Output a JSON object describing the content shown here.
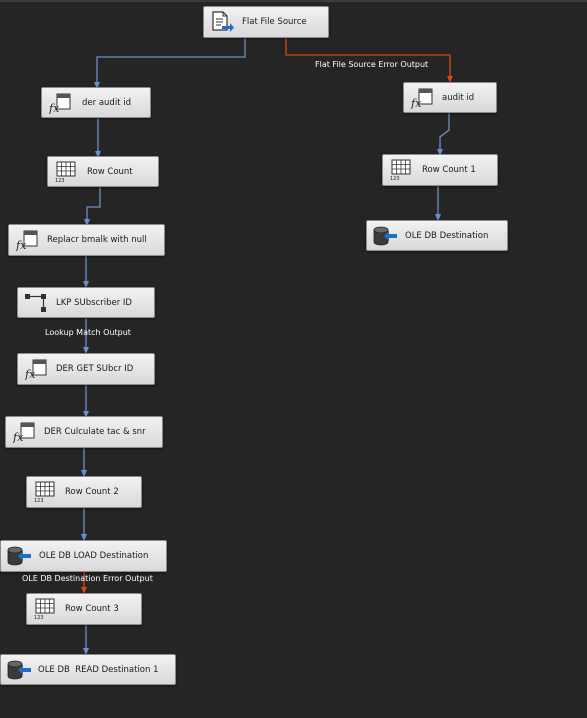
{
  "nodes": {
    "flat_file_source": {
      "label": "Flat File Source",
      "icon": "flat-file-source-icon"
    },
    "der_audit_id": {
      "label": "der audit id",
      "icon": "derived-column-icon"
    },
    "audit_id": {
      "label": "audit id",
      "icon": "derived-column-icon"
    },
    "row_count": {
      "label": "Row Count",
      "icon": "row-count-icon"
    },
    "row_count_1": {
      "label": "Row Count 1",
      "icon": "row-count-icon"
    },
    "replace_blank": {
      "label": "Replacr bmalk with null",
      "icon": "derived-column-icon"
    },
    "ole_db_destination": {
      "label": "OLE DB Destination",
      "icon": "ole-db-destination-icon"
    },
    "lkp_subscriber": {
      "label": "LKP SUbscriber ID",
      "icon": "lookup-icon"
    },
    "der_get_subcr": {
      "label": "DER GET SUbcr ID",
      "icon": "derived-column-icon"
    },
    "der_calculate": {
      "label": "DER Culculate tac & snr",
      "icon": "derived-column-icon"
    },
    "row_count_2": {
      "label": "Row Count 2",
      "icon": "row-count-icon"
    },
    "ole_db_load": {
      "label": "OLE DB LOAD Destination",
      "icon": "ole-db-destination-icon"
    },
    "row_count_3": {
      "label": "Row Count 3",
      "icon": "row-count-icon"
    },
    "ole_db_read": {
      "label": "OLE DB  READ Destination 1",
      "icon": "ole-db-destination-icon"
    }
  },
  "path_labels": {
    "flat_file_error": "Flat File Source Error Output",
    "lookup_match": "Lookup Match Output",
    "ole_db_error": "OLE DB Destination Error Output"
  },
  "colors": {
    "background": "#252525",
    "success_path": "#6b8fc7",
    "error_path": "#d4490f",
    "node_fill": "#e6e6e6",
    "node_border": "#8c8c8c",
    "icon_blue": "#1f6fc4"
  }
}
